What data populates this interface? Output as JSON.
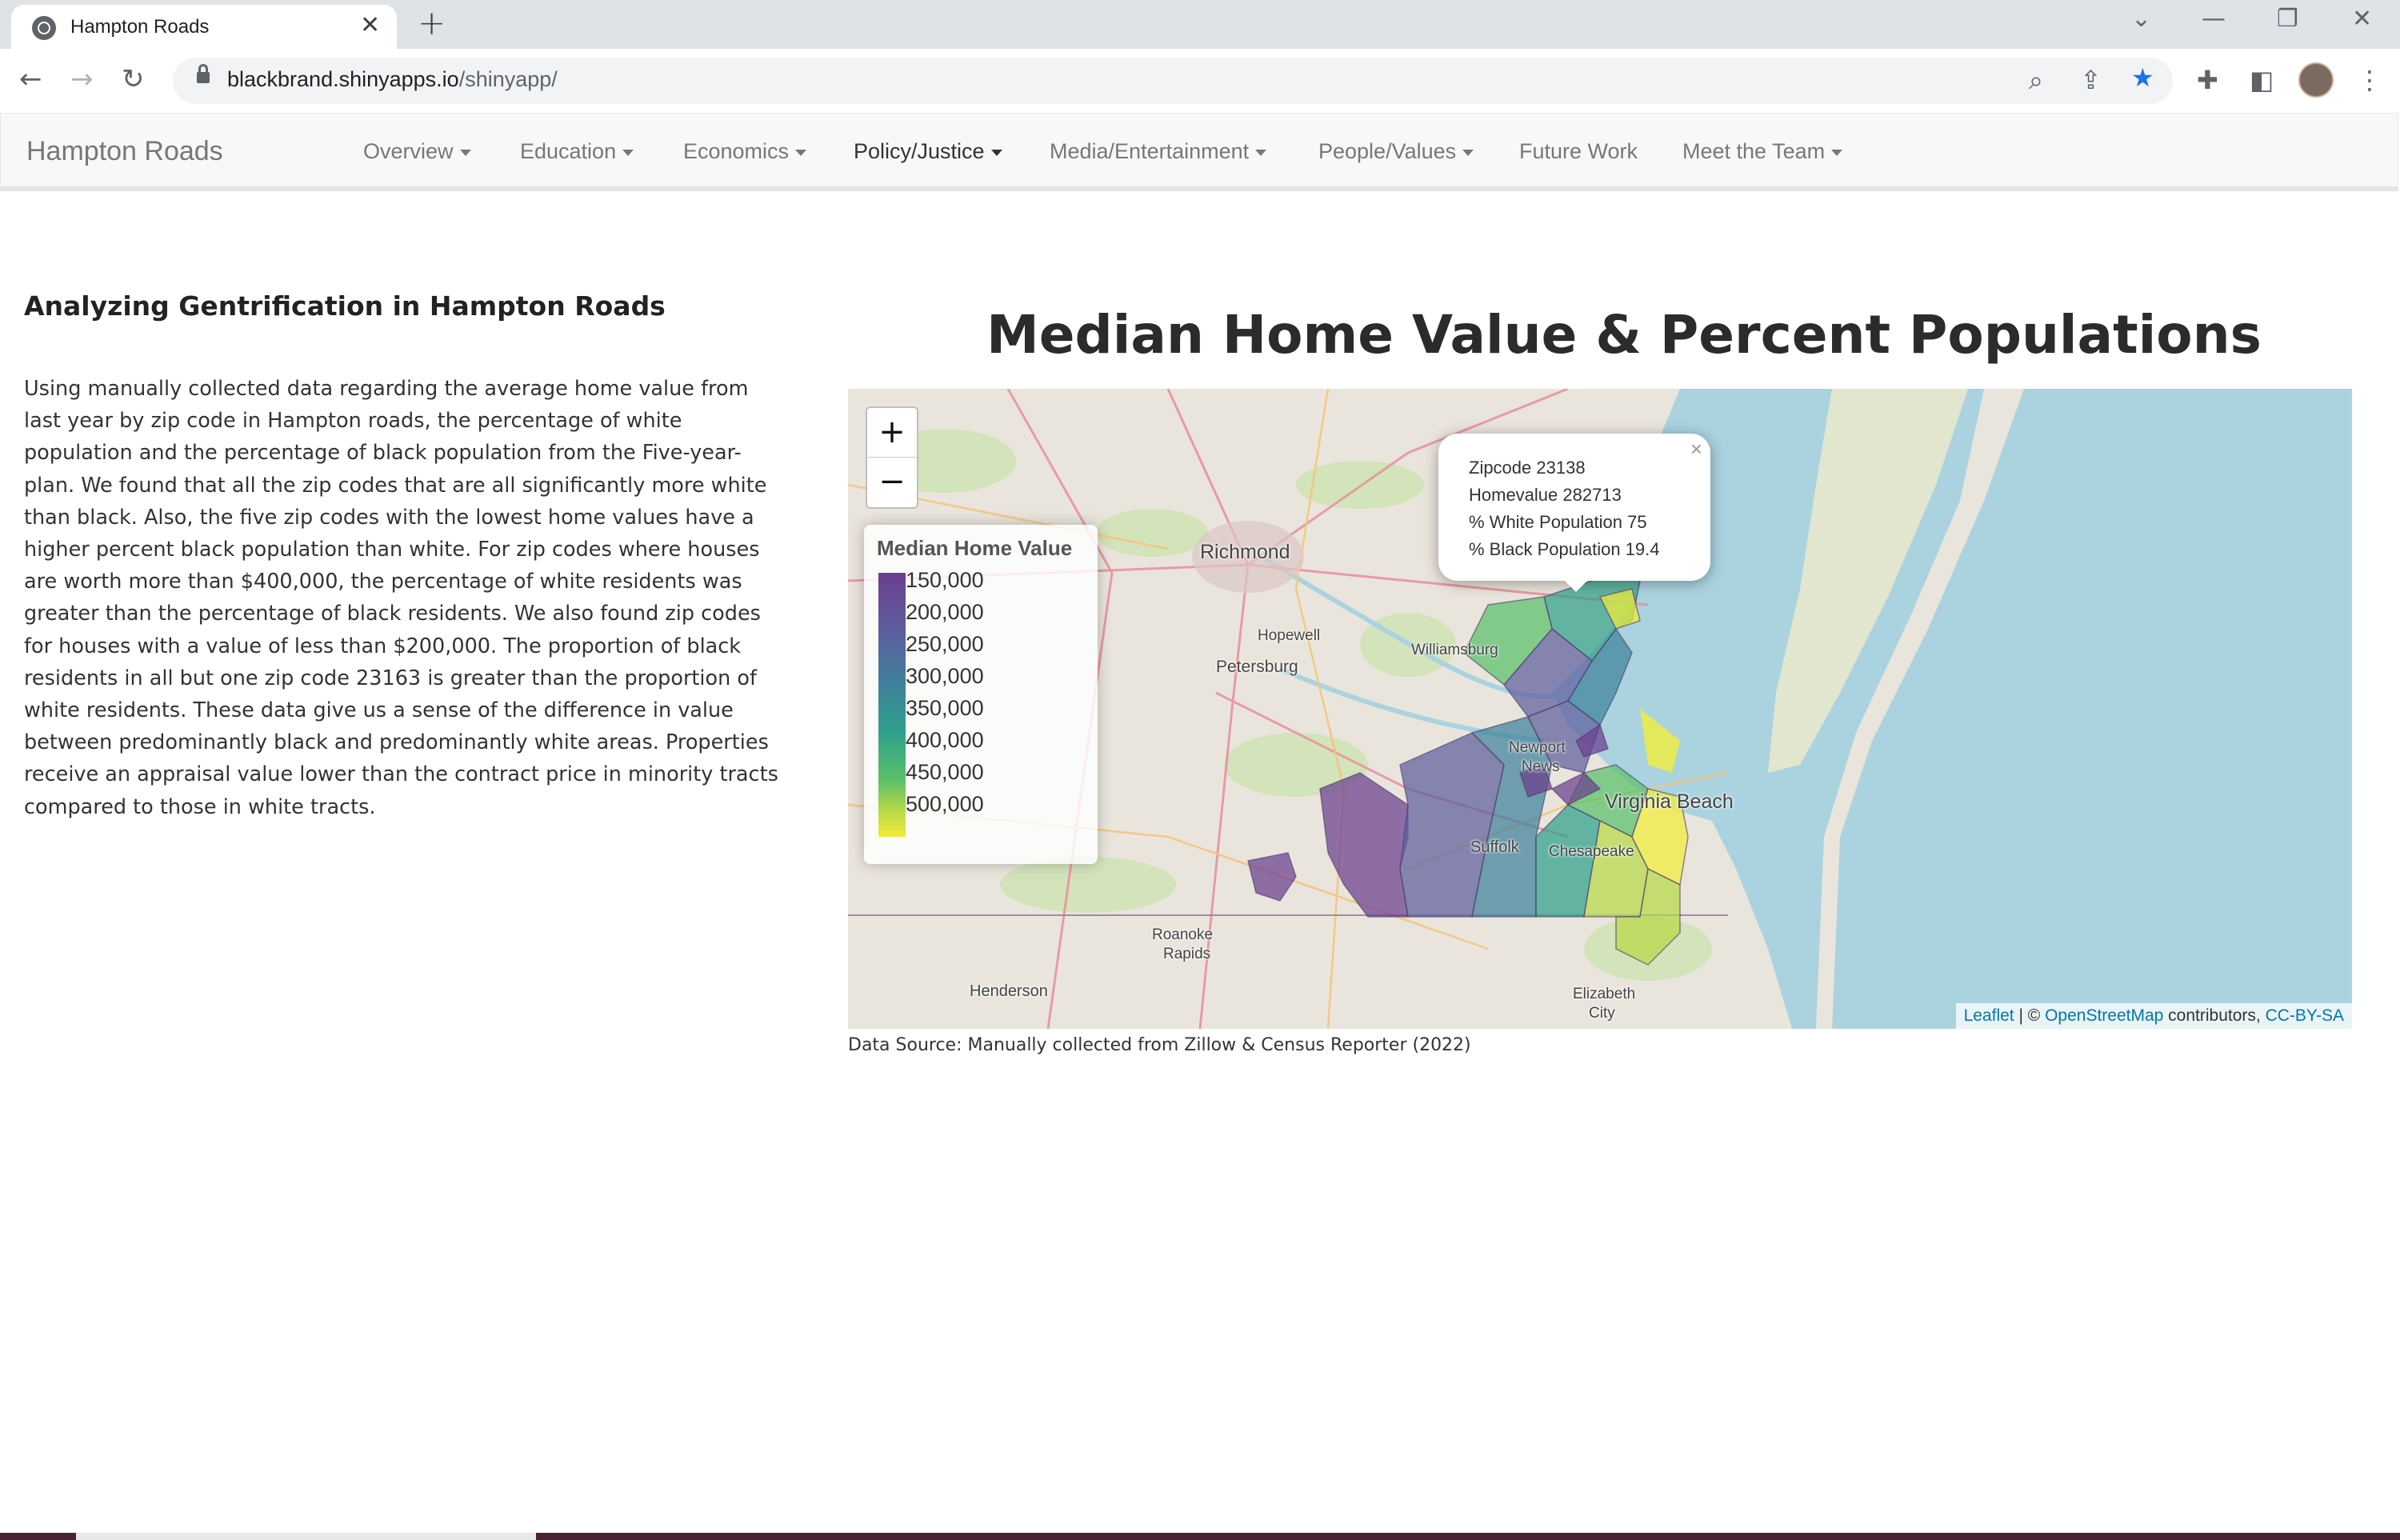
{
  "browser": {
    "tab_title": "Hampton Roads",
    "tab_close": "✕",
    "new_tab": "+",
    "url_host": "blackbrand.shinyapps.io",
    "url_path": "/shinyapp/",
    "controls": {
      "minimize": "—",
      "restore": "❐",
      "close": "✕",
      "tab_search": "⌄"
    }
  },
  "navbar": {
    "brand": "Hampton Roads",
    "items": [
      {
        "label": "Overview",
        "dropdown": true,
        "active": false
      },
      {
        "label": "Education",
        "dropdown": true,
        "active": false
      },
      {
        "label": "Economics",
        "dropdown": true,
        "active": false
      },
      {
        "label": "Policy/Justice",
        "dropdown": true,
        "active": true
      },
      {
        "label": "Media/Entertainment",
        "dropdown": true,
        "active": false
      },
      {
        "label": "People/Values",
        "dropdown": true,
        "active": false
      },
      {
        "label": "Future Work",
        "dropdown": false,
        "active": false
      },
      {
        "label": "Meet the Team",
        "dropdown": true,
        "active": false
      }
    ]
  },
  "left_panel": {
    "heading": "Analyzing Gentrification in Hampton Roads",
    "body": "Using manually collected data regarding the average home value from last year by zip code in Hampton roads, the percentage of white population and the percentage of black population from the Five-year-plan. We found that all the zip codes that are all significantly more white than black. Also, the five zip codes with the lowest home values have a higher percent black population than white. For zip codes where houses are worth more than $400,000, the percentage of white residents was greater than the percentage of black residents. We also found zip codes for houses with a value of less than $200,000. The proportion of black residents in all but one zip code 23163 is greater than the proportion of white residents. These data give us a sense of the difference in value between predominantly black and predominantly white areas. Properties receive an appraisal value lower than the contract price in minority tracts compared to those in white tracts."
  },
  "map": {
    "title": "Median Home Value & Percent Populations",
    "zoom_in": "+",
    "zoom_out": "−",
    "legend": {
      "title": "Median Home Value",
      "ticks": [
        "150,000",
        "200,000",
        "250,000",
        "300,000",
        "350,000",
        "400,000",
        "450,000",
        "500,000"
      ],
      "colors": [
        "#6b3f8f",
        "#5d5e9e",
        "#3f819b",
        "#2e9f8b",
        "#59bf6b",
        "#b6d847",
        "#f3ed39"
      ]
    },
    "popup": {
      "close": "×",
      "lines": [
        "Zipcode 23138",
        "Homevalue 282713",
        "% White Population 75",
        "% Black Population 19.4"
      ]
    },
    "places": [
      "Richmond",
      "Hopewell",
      "Petersburg",
      "Williamsburg",
      "Newport",
      "News",
      "Virginia Beach",
      "Suffolk",
      "Chesapeake",
      "Roanoke",
      "Rapids",
      "Henderson",
      "Elizabeth",
      "City"
    ],
    "attribution": {
      "leaflet": "Leaflet",
      "sep": " | © ",
      "osm": "OpenStreetMap",
      "contributors": " contributors, ",
      "license": "CC-BY-SA"
    },
    "water_color": "#aad3df",
    "land_color": "#eae5dc"
  },
  "data_source": "Data Source: Manually collected from Zillow & Census Reporter (2022)"
}
